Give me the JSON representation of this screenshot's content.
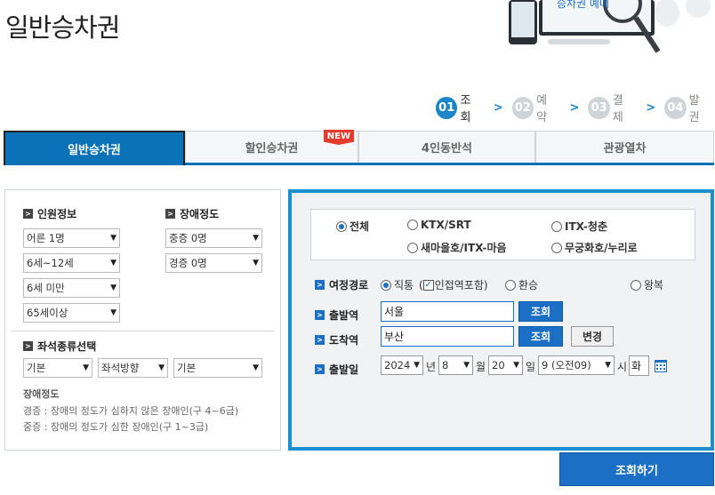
{
  "page_title": "일반승차권",
  "hero_text": "승차권 예매",
  "steps": [
    {
      "num": "01",
      "label": "조회"
    },
    {
      "num": "02",
      "label": "예약"
    },
    {
      "num": "03",
      "label": "결제"
    },
    {
      "num": "04",
      "label": "발권"
    }
  ],
  "tabs": [
    "일반승차권",
    "할인승차권",
    "4인동반석",
    "관광열차"
  ],
  "new_badge": "NEW",
  "passenger": {
    "heading": "인원정보",
    "selects": [
      "어른 1명",
      "6세~12세",
      "6세 미만",
      "65세이상"
    ]
  },
  "disability": {
    "heading": "장애정도",
    "selects": [
      "중증 0명",
      "경증 0명"
    ]
  },
  "seat": {
    "heading": "좌석종류선택",
    "selects": [
      "기본",
      "좌석방향",
      "기본"
    ]
  },
  "note": {
    "title": "장애정도",
    "line1": "경증 : 장애의 정도가 심하지 않은 장애인(구 4~6급)",
    "line2": "중증 : 장애의 정도가 심한 장애인(구 1~3급)"
  },
  "train_types": [
    "전체",
    "KTX/SRT",
    "ITX-청춘",
    "새마을호/ITX-마음",
    "무궁화호/누리로"
  ],
  "route": {
    "label": "여정경로",
    "options": [
      "직통",
      "인접역포함",
      "환승",
      "왕복"
    ],
    "paren_open": "(",
    "paren_close": ")"
  },
  "departure": {
    "label": "출발역",
    "value": "서울",
    "button": "조회"
  },
  "arrival": {
    "label": "도착역",
    "value": "부산",
    "button": "조회",
    "change_button": "변경"
  },
  "date": {
    "label": "출발일",
    "year": "2024",
    "year_unit": "년",
    "month": "8",
    "month_unit": "월",
    "day": "20",
    "day_unit": "일",
    "hour": "9 (오전09)",
    "hour_unit": "시",
    "weekday": "화"
  },
  "search_button": "조회하기",
  "colors": {
    "accent": "#1b6fc5",
    "tab_active": "#0b72b7",
    "frame": "#1b8fd0",
    "badge": "#e53b2f"
  }
}
